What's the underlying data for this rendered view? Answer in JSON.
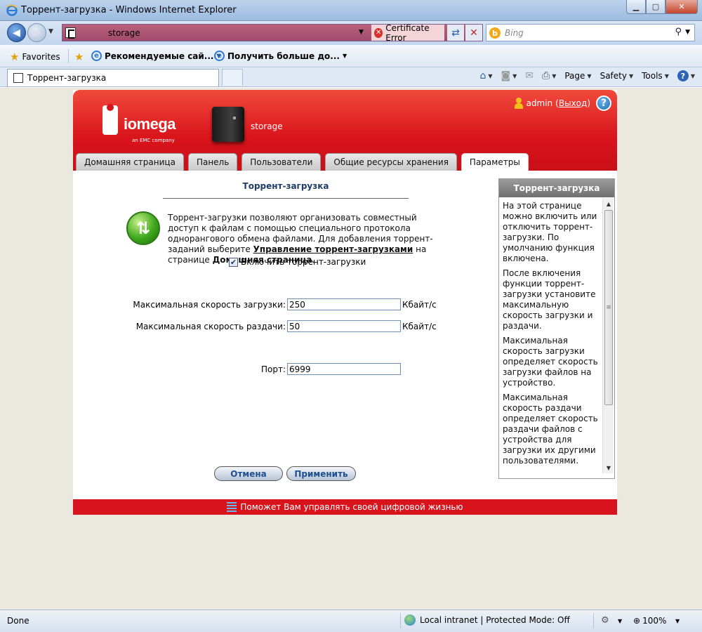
{
  "window": {
    "title": "Торрент-загрузка - Windows Internet Explorer"
  },
  "address": {
    "url": "storage",
    "cert_error": "Certificate Error"
  },
  "search": {
    "placeholder": "Bing"
  },
  "favorites": {
    "label": "Favorites",
    "items": [
      "Рекомендуемые сай...",
      "Получить больше до..."
    ]
  },
  "tab": {
    "label": "Торрент-загрузка"
  },
  "commands": {
    "page": "Page",
    "safety": "Safety",
    "tools": "Tools"
  },
  "app": {
    "logo_text": "iomega",
    "logo_sub": "an EMC company",
    "device_name": "storage",
    "user": "admin",
    "logout_open": "(",
    "logout": "Выход",
    "logout_close": ")",
    "tabs": [
      "Домашняя страница",
      "Панель",
      "Пользователи",
      "Общие ресурсы хранения",
      "Параметры"
    ],
    "active_tab": 4
  },
  "content": {
    "title": "Торрент-загрузка",
    "desc_part1": "Торрент-загрузки позволяют организовать совместный доступ к файлам с помощью специального протокола однорангового обмена файлами. Для добавления торрент-заданий выберите ",
    "desc_link": "Управление торрент-загрузками",
    "desc_part2": " на странице ",
    "desc_bold": "Домашняя страница",
    "desc_end": ".",
    "enable_label": "Включить торрент-загрузки",
    "enabled": true,
    "download_label": "Максимальная скорость загрузки:",
    "download_value": "250",
    "upload_label": "Максимальная скорость раздачи:",
    "upload_value": "50",
    "unit": "Кбайт/с",
    "port_label": "Порт:",
    "port_value": "6999",
    "cancel": "Отмена",
    "apply": "Применить"
  },
  "help": {
    "title": "Торрент-загрузка",
    "paragraphs": [
      "На этой странице можно включить или отключить торрент-загрузки. По умолчанию функция включена.",
      "После включения функции торрент-загрузки установите максимальную скорость загрузки и раздачи.",
      "Максимальная скорость загрузки определяет скорость загрузки файлов на устройство.",
      "Максимальная скорость раздачи определяет скорость раздачи файлов с устройства для загрузки их другими пользователями."
    ]
  },
  "footer": {
    "text": "Поможет Вам управлять своей цифровой жизнью"
  },
  "status": {
    "text": "Done",
    "zone": "Local intranet | Protected Mode: Off",
    "zoom": "100%"
  },
  "colors": {
    "brand_red": "#d9131b",
    "link_blue": "#1d4f8f"
  }
}
